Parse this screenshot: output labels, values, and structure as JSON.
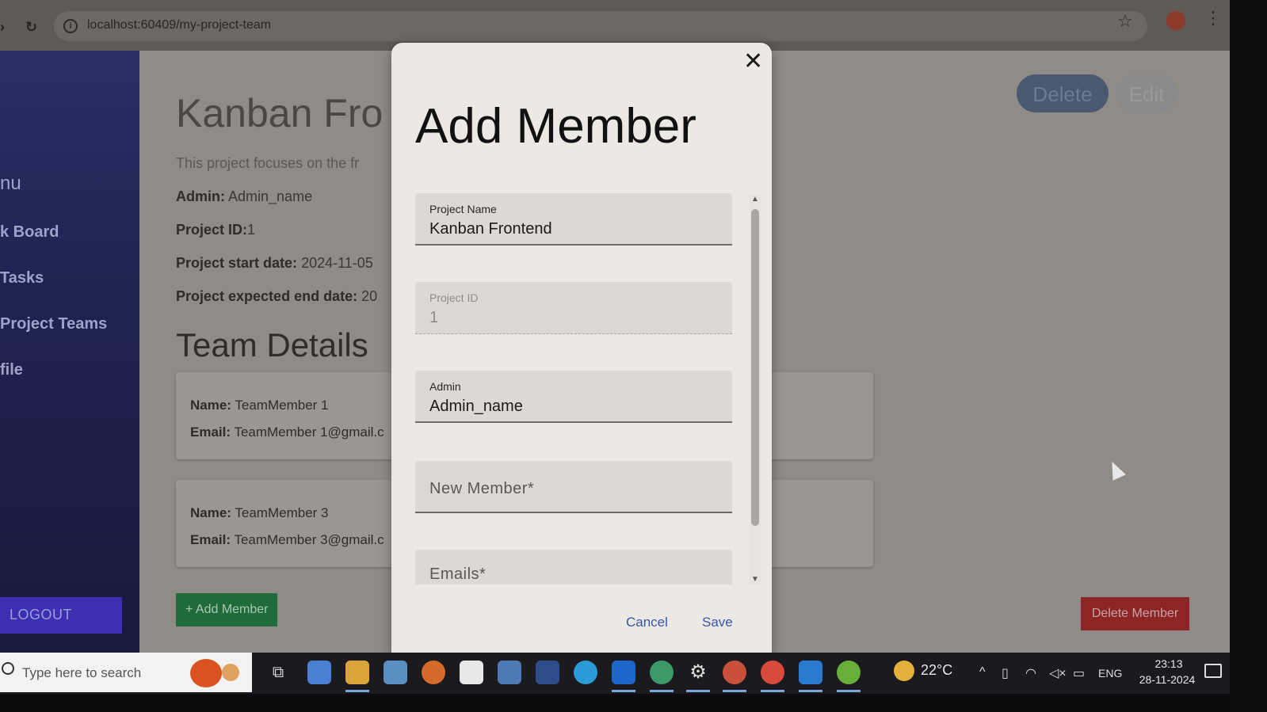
{
  "browser": {
    "url": "localhost:60409/my-project-team",
    "reload_icon": "↻",
    "star_icon": "☆",
    "menu_icon": "⋮"
  },
  "sidebar": {
    "items": [
      {
        "label": "nu"
      },
      {
        "label": "k Board"
      },
      {
        "label": "Tasks"
      },
      {
        "label": "Project Teams"
      },
      {
        "label": "file"
      }
    ],
    "logout_label": "LOGOUT"
  },
  "project": {
    "title": "Kanban Fro",
    "description": "This project focuses on the fr",
    "admin_label": "Admin:",
    "admin_value": "Admin_name",
    "id_label": "Project ID:",
    "id_value": "1",
    "start_label": "Project start date:",
    "start_value": "2024-11-05",
    "end_label": "Project expected end date:",
    "end_value": "20",
    "delete_label": "Delete",
    "edit_label": "Edit"
  },
  "team": {
    "heading": "Team Details",
    "members": [
      {
        "name_label": "Name:",
        "name": "TeamMember 1",
        "email_label": "Email:",
        "email": "TeamMember 1@gmail.c"
      },
      {
        "name_label": "Name:",
        "name": "TeamMember 3",
        "email_label": "Email:",
        "email": "TeamMember 3@gmail.c"
      }
    ],
    "add_member_label": "+ Add Member",
    "delete_member_label": "Delete Member"
  },
  "modal": {
    "title": "Add Member",
    "close_icon": "✕",
    "fields": [
      {
        "label": "Project Name",
        "value": "Kanban Frontend"
      },
      {
        "label": "Project ID",
        "value": "1"
      },
      {
        "label": "Admin",
        "value": "Admin_name"
      },
      {
        "placeholder": "New Member*"
      },
      {
        "placeholder": "Emails*"
      }
    ],
    "cancel_label": "Cancel",
    "save_label": "Save"
  },
  "taskbar": {
    "search_placeholder": "Type here to search",
    "weather": "22°C",
    "language": "ENG",
    "time": "23:13",
    "date": "28-11-2024"
  }
}
